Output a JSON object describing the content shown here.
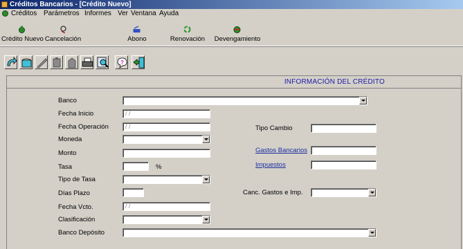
{
  "window": {
    "title": "Créditos Bancarios - [Crédito Nuevo]"
  },
  "menu": [
    "Créditos",
    "Parámetros",
    "Informes",
    "Ver",
    "Ventana",
    "Ayuda"
  ],
  "toolbar": [
    {
      "label": "Crédito Nuevo",
      "icon": "money-bag-icon"
    },
    {
      "label": "Cancelación",
      "icon": "cancel-icon"
    },
    {
      "label": "Abono",
      "icon": "deposit-icon"
    },
    {
      "label": "Renovación",
      "icon": "recycle-icon"
    },
    {
      "label": "Devengamiento",
      "icon": "accrual-icon"
    }
  ],
  "action_icons": [
    "undo-icon",
    "open-icon",
    "edit-icon",
    "copy-icon",
    "paste-icon",
    "print-icon",
    "search-icon",
    "help-icon",
    "exit-icon"
  ],
  "section_title": "INFORMACIÓN DEL CRÉDITO",
  "form": {
    "banco": {
      "label": "Banco",
      "value": ""
    },
    "fecha_inicio": {
      "label": "Fecha Inicio",
      "value": "/ /"
    },
    "fecha_operacion": {
      "label": "Fecha Operación",
      "value": "/ /"
    },
    "moneda": {
      "label": "Moneda",
      "value": ""
    },
    "monto": {
      "label": "Monto",
      "value": ""
    },
    "tasa": {
      "label": "Tasa",
      "value": "",
      "unit": "%"
    },
    "tipo_tasa": {
      "label": "Tipo de Tasa",
      "value": ""
    },
    "dias_plazo": {
      "label": "Días Plazo",
      "value": ""
    },
    "fecha_vcto": {
      "label": "Fecha Vcto.",
      "value": "/ /"
    },
    "clasificacion": {
      "label": "Clasificación",
      "value": ""
    },
    "banco_deposito": {
      "label": "Banco Depósito",
      "value": ""
    },
    "tipo_cambio": {
      "label": "Tipo Cambio",
      "value": ""
    },
    "gastos_bancarios": {
      "label": "Gastos Bancarios",
      "value": ""
    },
    "impuestos": {
      "label": "Impuestos",
      "value": ""
    },
    "canc_gastos": {
      "label": "Canc. Gastos e Imp.",
      "value": ""
    }
  }
}
